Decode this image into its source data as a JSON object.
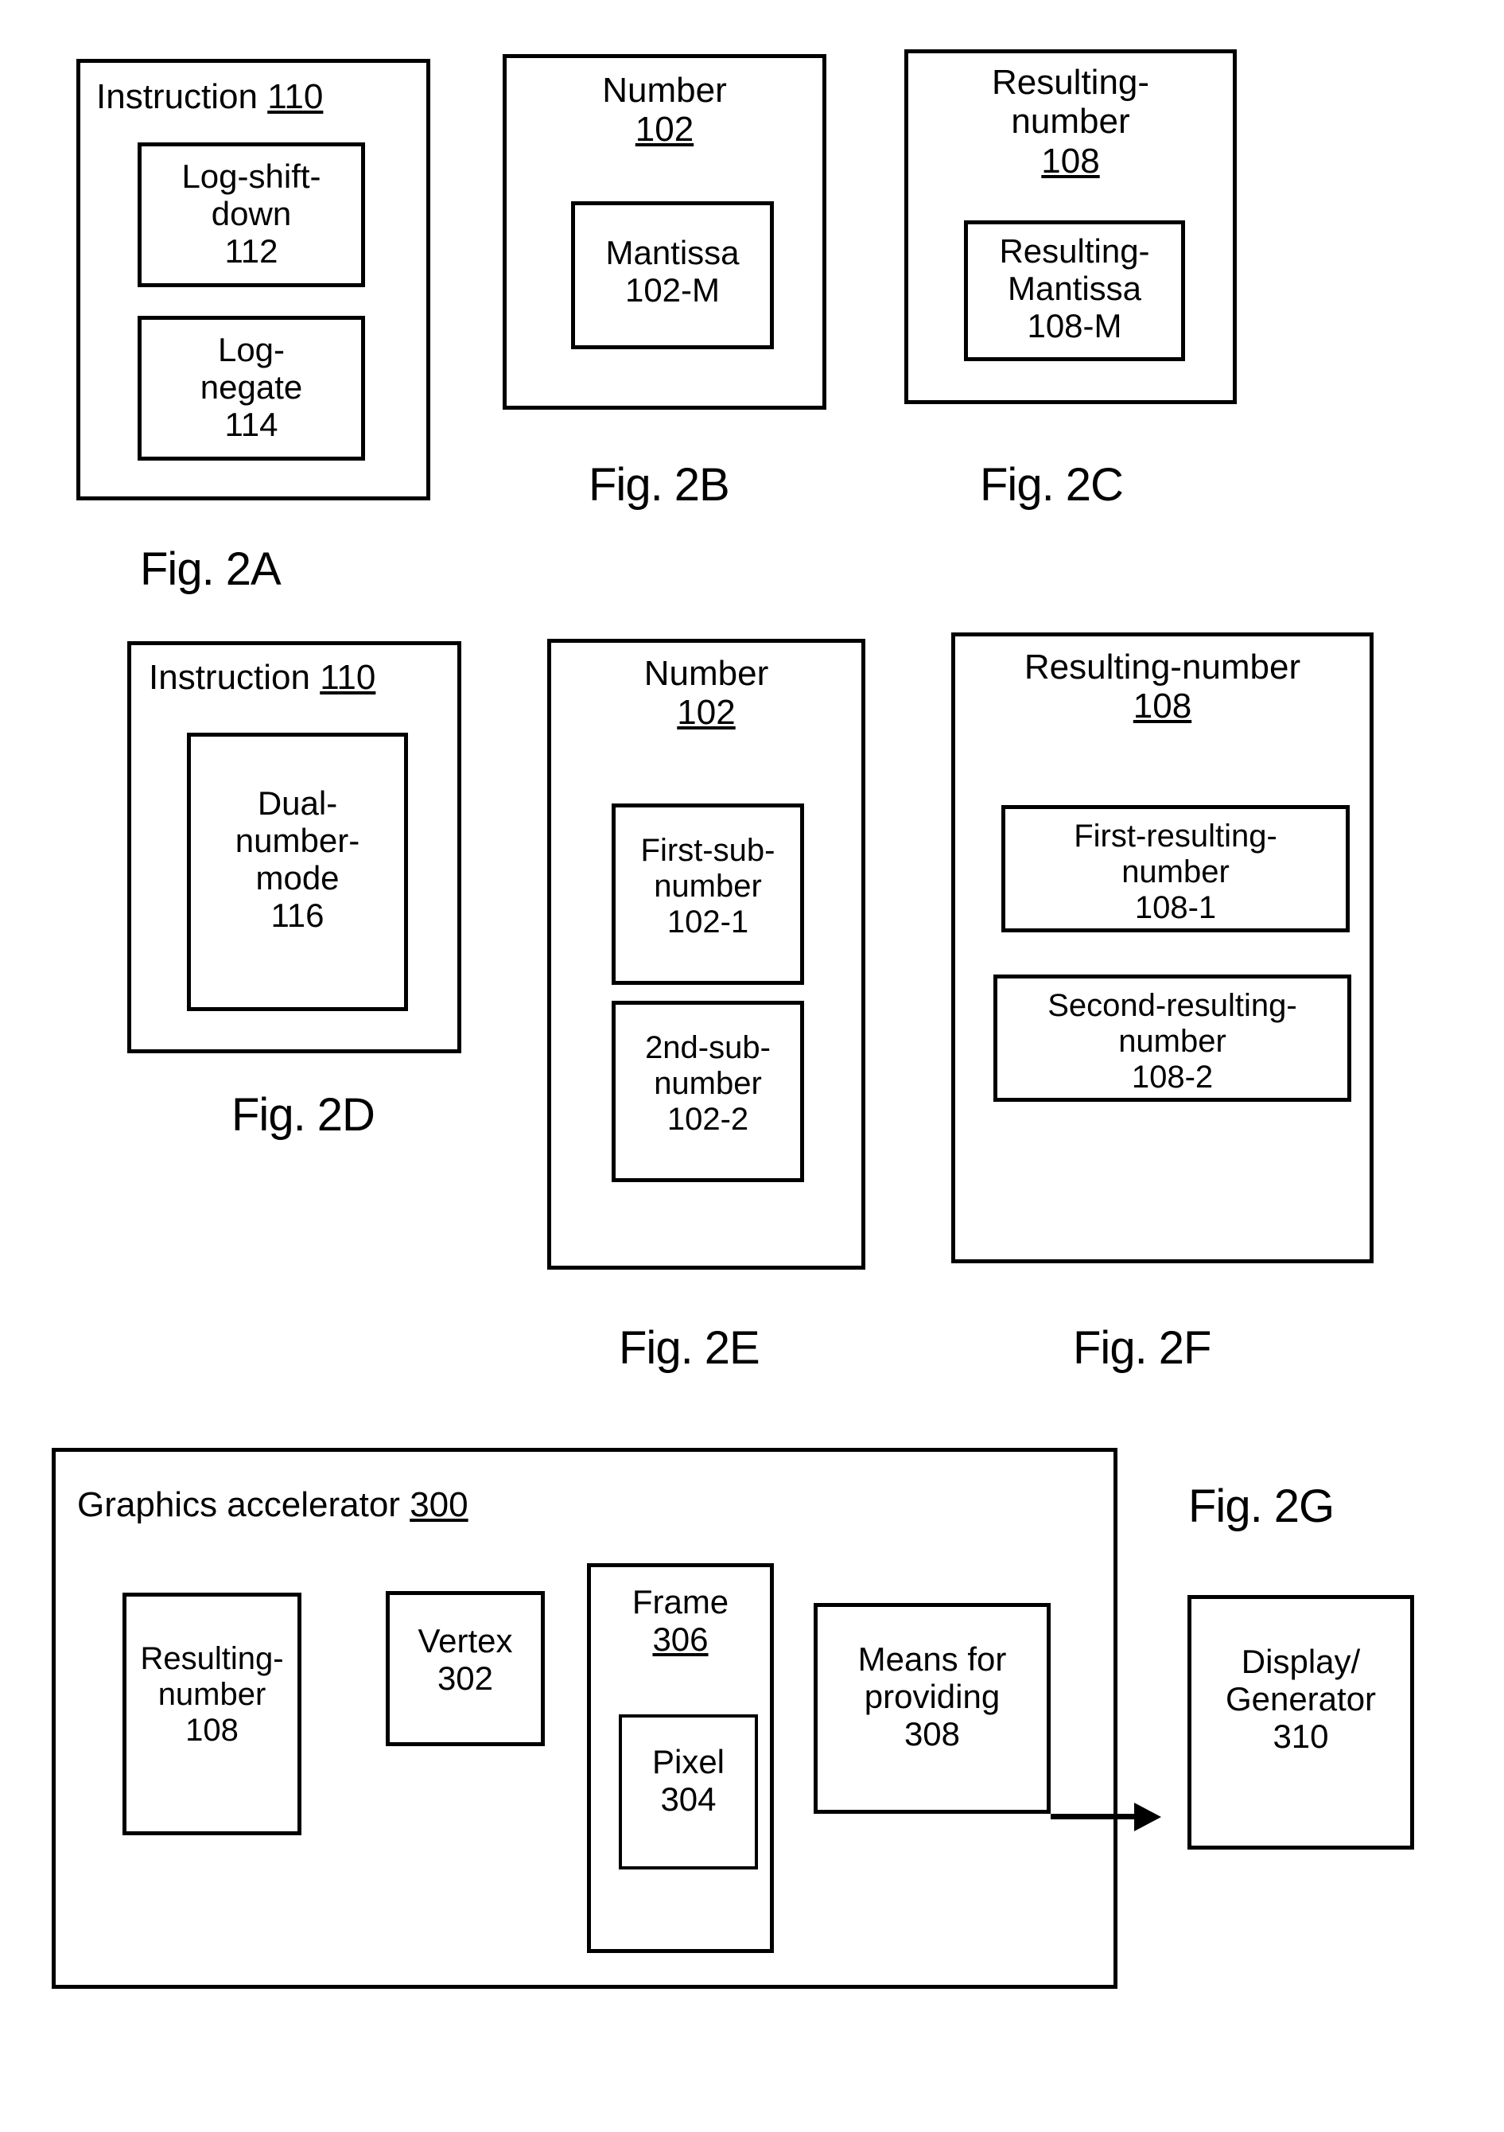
{
  "figures": {
    "fig2a": {
      "caption": "Fig. 2A",
      "outer_label": "Instruction",
      "outer_ref": "110",
      "children": [
        {
          "label": "Log-shift-\ndown\n112"
        },
        {
          "label": "Log-\nnegate\n114"
        }
      ]
    },
    "fig2b": {
      "caption": "Fig. 2B",
      "outer_label": "Number",
      "outer_ref": "102",
      "children": [
        {
          "label": "Mantissa\n102-M"
        }
      ]
    },
    "fig2c": {
      "caption": "Fig. 2C",
      "outer_label": "Resulting-\nnumber",
      "outer_ref": "108",
      "children": [
        {
          "label": "Resulting-\nMantissa\n108-M"
        }
      ]
    },
    "fig2d": {
      "caption": "Fig. 2D",
      "outer_label": "Instruction",
      "outer_ref": "110",
      "children": [
        {
          "label": "Dual-\nnumber-\nmode\n116"
        }
      ]
    },
    "fig2e": {
      "caption": "Fig. 2E",
      "outer_label": "Number",
      "outer_ref": "102",
      "children": [
        {
          "label": "First-sub-\nnumber\n102-1"
        },
        {
          "label": "2nd-sub-\nnumber\n102-2"
        }
      ]
    },
    "fig2f": {
      "caption": "Fig. 2F",
      "outer_label": "Resulting-number",
      "outer_ref": "108",
      "children": [
        {
          "label": "First-resulting-\nnumber\n108-1"
        },
        {
          "label": "Second-resulting-\nnumber\n108-2"
        }
      ]
    },
    "fig2g": {
      "caption": "Fig. 2G",
      "outer_label": "Graphics accelerator",
      "outer_ref": "300",
      "children": [
        {
          "label": "Resulting-\nnumber\n108"
        },
        {
          "label": "Vertex\n302"
        },
        {
          "label": "Frame",
          "ref": "306"
        },
        {
          "label": "Pixel\n304"
        },
        {
          "label": "Means for\nproviding\n308"
        },
        {
          "label": "Display/\nGenerator\n310"
        }
      ]
    }
  },
  "colors": {
    "stroke": "#000000",
    "background": "#ffffff"
  }
}
